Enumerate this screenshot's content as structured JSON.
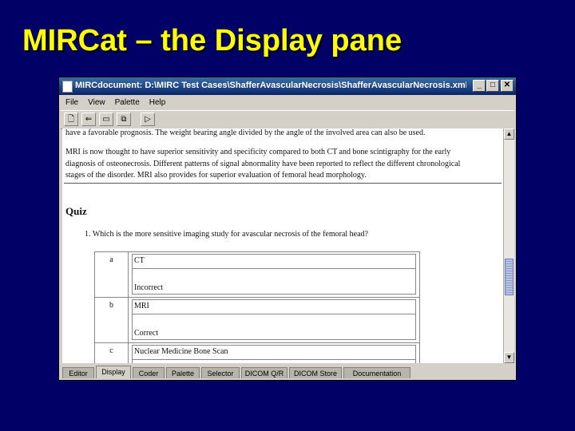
{
  "slide": {
    "title": "MIRCat – the Display pane"
  },
  "window": {
    "title": "MIRCdocument: D:\\MIRC Test Cases\\ShafferAvascularNecrosis\\ShafferAvascularNecrosis.xml",
    "menu": [
      "File",
      "View",
      "Palette",
      "Help"
    ],
    "toolbar": [
      "new-doc-icon",
      "open-icon",
      "save-icon",
      "copy-icon",
      "preview-icon"
    ]
  },
  "content": {
    "paragraph1": "have a favorable prognosis. The weight bearing angle divided by the angle of the involved area can also be used.",
    "paragraph2_lines": [
      "MRI is now thought to have superior sensitivity and specificity compared to both CT and bone scintigraphy for the early",
      "diagnosis of osteonecrosis. Different patterns of signal abnormality have been reported to reflect the different chronological",
      "stages of the disorder. MRI also provides for superior evaluation of femoral head morphology."
    ],
    "quiz_title": "Quiz",
    "question": "1.  Which is the more sensitive imaging study for avascular necrosis of the femoral head?",
    "answers": [
      {
        "letter": "a",
        "answer": "CT",
        "feedback": "Incorrect"
      },
      {
        "letter": "b",
        "answer": "MRI",
        "feedback": "Correct"
      },
      {
        "letter": "c",
        "answer": "Nuclear Medicine Bone Scan",
        "feedback": ""
      }
    ]
  },
  "tabs": [
    {
      "label": "Editor",
      "active": false
    },
    {
      "label": "Display",
      "active": true
    },
    {
      "label": "Coder",
      "active": false
    },
    {
      "label": "Palette",
      "active": false
    },
    {
      "label": "Selector",
      "active": false
    },
    {
      "label": "DICOM Q/R",
      "active": false
    },
    {
      "label": "DICOM Store",
      "active": false
    },
    {
      "label": "Documentation",
      "active": false
    }
  ],
  "colors": {
    "slide_background": "#000066",
    "title_text": "#ffff00",
    "titlebar": "#0a246a",
    "scroll_thumb": "#8c9cc8"
  }
}
